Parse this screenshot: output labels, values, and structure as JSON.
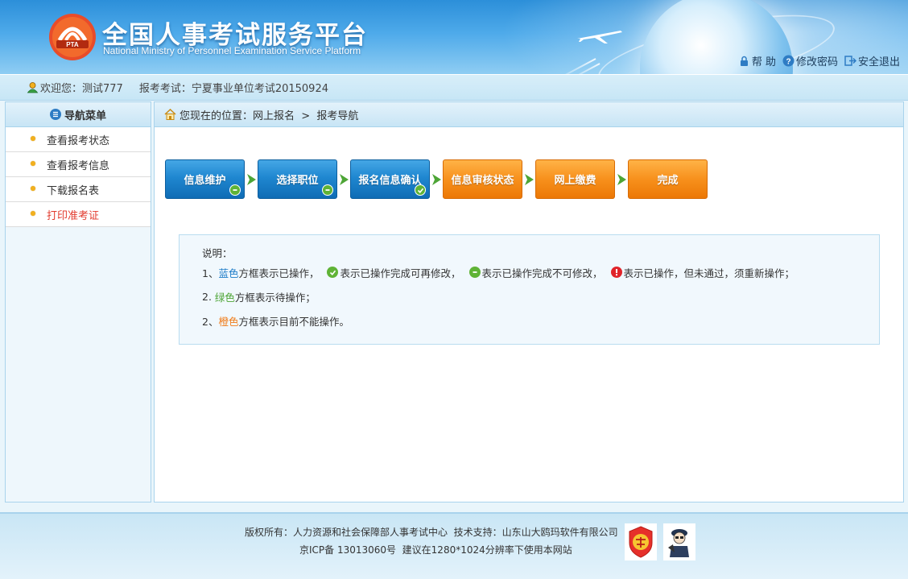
{
  "header": {
    "logo_text": "PTA",
    "title": "全国人事考试服务平台",
    "subtitle": "National Ministry of Personnel Examination Service Platform",
    "links": [
      {
        "label": "帮 助",
        "icon": "lock-icon"
      },
      {
        "label": "修改密码",
        "icon": "question-icon"
      },
      {
        "label": "安全退出",
        "icon": "logout-icon"
      }
    ]
  },
  "userbar": {
    "welcome": "欢迎您：测试777",
    "exam": "报考考试：宁夏事业单位考试20150924"
  },
  "sidebar": {
    "title": "导航菜单",
    "items": [
      {
        "label": "查看报考状态"
      },
      {
        "label": "查看报考信息"
      },
      {
        "label": "下载报名表"
      },
      {
        "label": "打印准考证"
      }
    ]
  },
  "breadcrumb": {
    "text": "您现在的位置：网上报名  >  报考导航"
  },
  "steps": [
    {
      "label": "信息维护",
      "color": "blue",
      "badge": "minus"
    },
    {
      "label": "选择职位",
      "color": "blue",
      "badge": "minus"
    },
    {
      "label": "报名信息确认",
      "color": "blue",
      "badge": "check"
    },
    {
      "label": "信息审核状态",
      "color": "orange",
      "badge": ""
    },
    {
      "label": "网上缴费",
      "color": "orange",
      "badge": ""
    },
    {
      "label": "完成",
      "color": "orange",
      "badge": ""
    }
  ],
  "note": {
    "title": "说明：",
    "line1": {
      "prefix": "1、",
      "color_word": "蓝色",
      "text1": "方框表示已操作，",
      "text2": "表示已操作完成可再修改，",
      "text3": "表示已操作完成不可修改，",
      "text4": "表示已操作，但未通过，须重新操作；"
    },
    "line2": {
      "prefix": "2. ",
      "color_word": "绿色",
      "text": "方框表示待操作；"
    },
    "line3": {
      "prefix": "2、",
      "color_word": "橙色",
      "text": "方框表示目前不能操作。"
    }
  },
  "footer": {
    "line1": "版权所有：人力资源和社会保障部人事考试中心  技术支持：山东山大鸥玛软件有限公司",
    "line2": "京ICP备 13013060号  建议在1280*1024分辨率下使用本网站"
  },
  "colors": {
    "blue_step": "#1f87d0",
    "orange_step": "#f7901c",
    "active_menu": "#e23b2e",
    "header": "#2c8fd9"
  }
}
